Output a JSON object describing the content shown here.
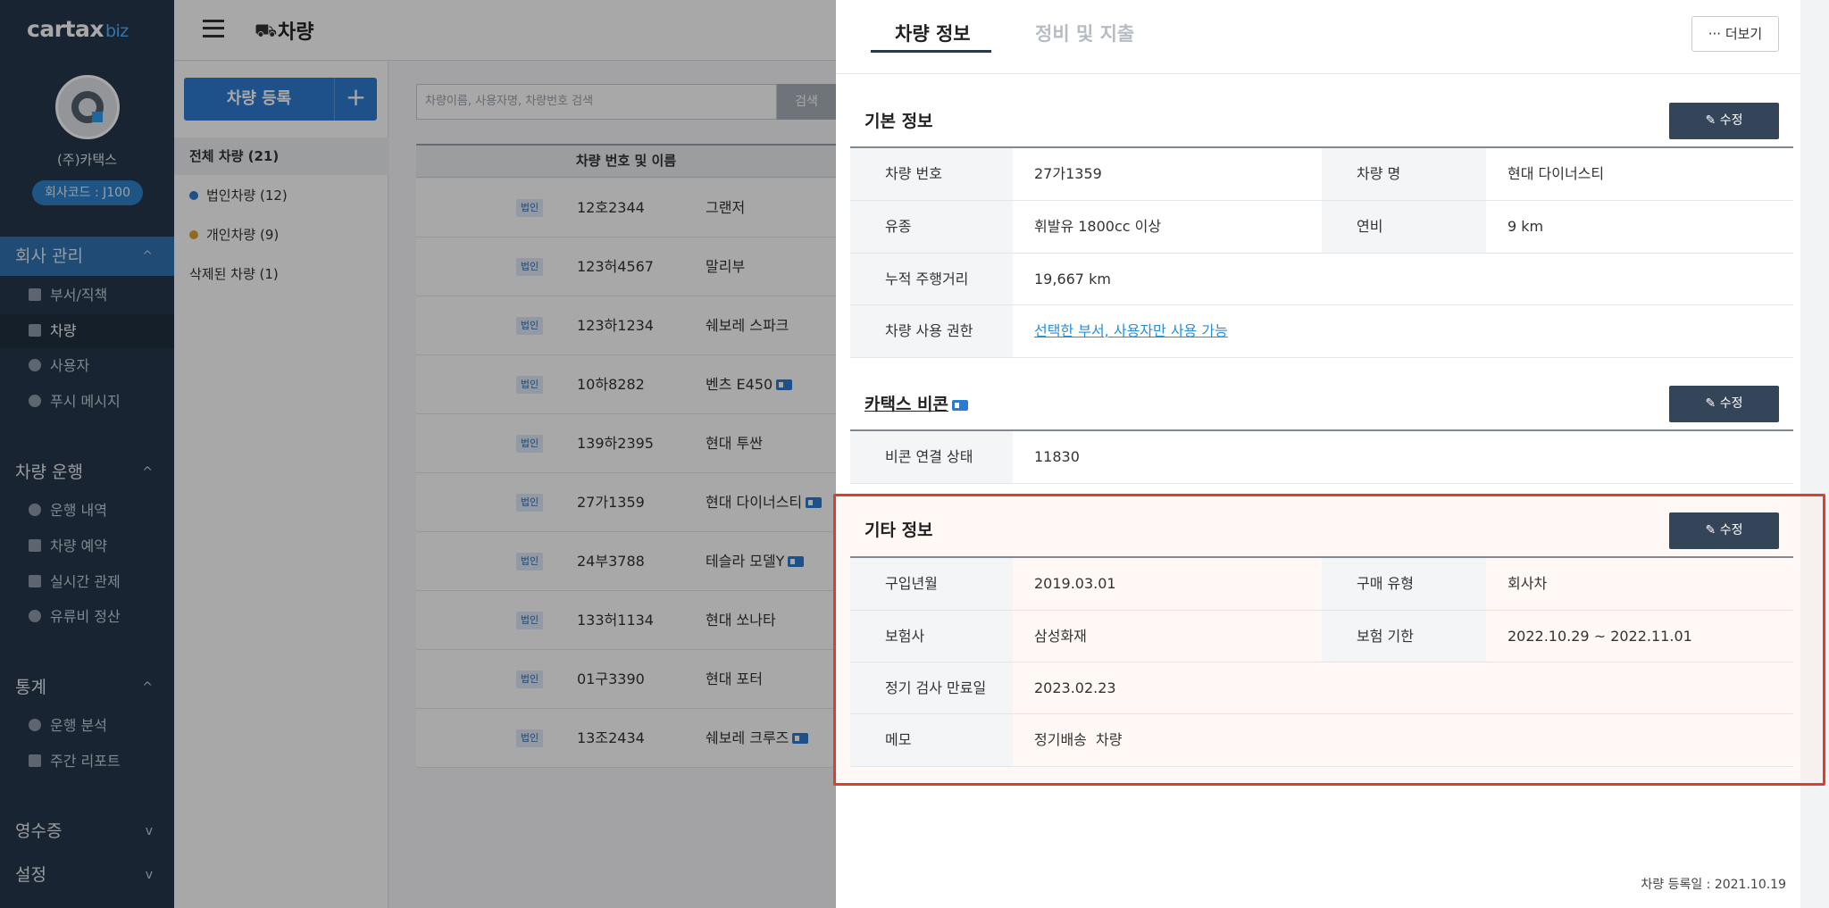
{
  "sidebar": {
    "logo": "cartax",
    "logo_suffix": "biz",
    "company_name": "(주)카택스",
    "company_code": "회사코드 : J100",
    "groups": [
      {
        "label": "회사 관리",
        "chevron": "^",
        "items": [
          "부서/직책",
          "차량",
          "사용자",
          "푸시 메시지"
        ]
      },
      {
        "label": "차량 운행",
        "chevron": "^",
        "items": [
          "운행 내역",
          "차량 예약",
          "실시간 관제",
          "유류비 정산"
        ]
      },
      {
        "label": "통계",
        "chevron": "^",
        "items": [
          "운행 분석",
          "주간 리포트"
        ]
      },
      {
        "label": "영수증",
        "chevron": "v",
        "items": []
      },
      {
        "label": "설정",
        "chevron": "v",
        "items": []
      }
    ]
  },
  "topbar": {
    "title": "차량"
  },
  "left_panel": {
    "register_label": "차량 등록",
    "register_plus": "+",
    "categories": [
      "전체 차량 (21)",
      "법인차량 (12)",
      "개인차량 (9)",
      "삭제된 차량 (1)"
    ],
    "colors": {
      "corporate_dot": "#2e7ad0",
      "personal_dot": "#e0a030"
    }
  },
  "list": {
    "search_placeholder": "차량이름, 사용자명, 차량번호 검색",
    "search_button": "검색",
    "column_header": "차량 번호 및 이름",
    "rows": [
      {
        "badge": "법인",
        "number": "12호2344",
        "name": "그랜저",
        "beacon": false
      },
      {
        "badge": "법인",
        "number": "123허4567",
        "name": "말리부",
        "beacon": false
      },
      {
        "badge": "법인",
        "number": "123하1234",
        "name": "쉐보레 스파크",
        "beacon": false
      },
      {
        "badge": "법인",
        "number": "10하8282",
        "name": "벤츠 E450",
        "beacon": true
      },
      {
        "badge": "법인",
        "number": "139하2395",
        "name": "현대 투싼",
        "beacon": false
      },
      {
        "badge": "법인",
        "number": "27가1359",
        "name": "현대 다이너스티",
        "beacon": true
      },
      {
        "badge": "법인",
        "number": "24부3788",
        "name": "테슬라 모델Y",
        "beacon": true
      },
      {
        "badge": "법인",
        "number": "133허1134",
        "name": "현대 쏘나타",
        "beacon": false
      },
      {
        "badge": "법인",
        "number": "01구3390",
        "name": "현대 포터",
        "beacon": false
      },
      {
        "badge": "법인",
        "number": "13조2434",
        "name": "쉐보레 크루즈",
        "beacon": true
      }
    ]
  },
  "detail": {
    "tabs": [
      "차량 정보",
      "정비 및 지출"
    ],
    "more_label": "··· 더보기",
    "edit_label": "✎ 수정",
    "basic": {
      "title": "기본 정보",
      "vehicle_number_label": "차량 번호",
      "vehicle_number": "27가1359",
      "vehicle_name_label": "차량 명",
      "vehicle_name": "현대 다이너스티",
      "fuel_label": "유종",
      "fuel": "휘발유 1800cc 이상",
      "efficiency_label": "연비",
      "efficiency": "9 km",
      "mileage_label": "누적 주행거리",
      "mileage": "19,667 km",
      "permission_label": "차량 사용 권한",
      "permission": "선택한 부서, 사용자만 사용 가능"
    },
    "beacon": {
      "title": "카택스 비콘",
      "status_label": "비콘 연결 상태",
      "status": "11830"
    },
    "other": {
      "title": "기타 정보",
      "purchase_date_label": "구입년월",
      "purchase_date": "2019.03.01",
      "purchase_type_label": "구매 유형",
      "purchase_type": "회사차",
      "insurer_label": "보험사",
      "insurer": "삼성화재",
      "insurance_period_label": "보험 기한",
      "insurance_period": "2022.10.29 ~ 2022.11.01",
      "inspection_label": "정기 검사 만료일",
      "inspection": "2023.02.23",
      "memo_label": "메모",
      "memo": "정기배송  차량"
    },
    "registered": "차량 등록일 : 2021.10.19"
  },
  "colors": {
    "sidebar_bg": "#26384d",
    "accent": "#2e7ad0",
    "edit_button": "#344559",
    "highlight_border": "#e13c2c"
  }
}
